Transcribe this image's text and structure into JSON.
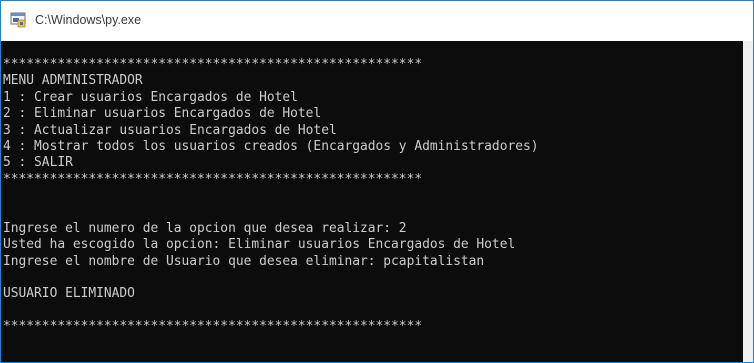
{
  "window": {
    "title": "C:\\Windows\\py.exe",
    "icon": "python-app-icon"
  },
  "console": {
    "lines": [
      "******************************************************",
      "MENU ADMINISTRADOR",
      "1 : Crear usuarios Encargados de Hotel",
      "2 : Eliminar usuarios Encargados de Hotel",
      "3 : Actualizar usuarios Encargados de Hotel",
      "4 : Mostrar todos los usuarios creados (Encargados y Administradores)",
      "5 : SALIR",
      "******************************************************",
      "",
      "",
      "Ingrese el numero de la opcion que desea realizar: 2",
      "Usted ha escogido la opcion: Eliminar usuarios Encargados de Hotel",
      "Ingrese el nombre de Usuario que desea eliminar: pcapitalistan",
      "",
      "USUARIO ELIMINADO",
      "",
      "******************************************************"
    ]
  },
  "colors": {
    "console_background": "#0c0c0c",
    "console_text": "#cccccc",
    "window_border": "#1883d7"
  }
}
